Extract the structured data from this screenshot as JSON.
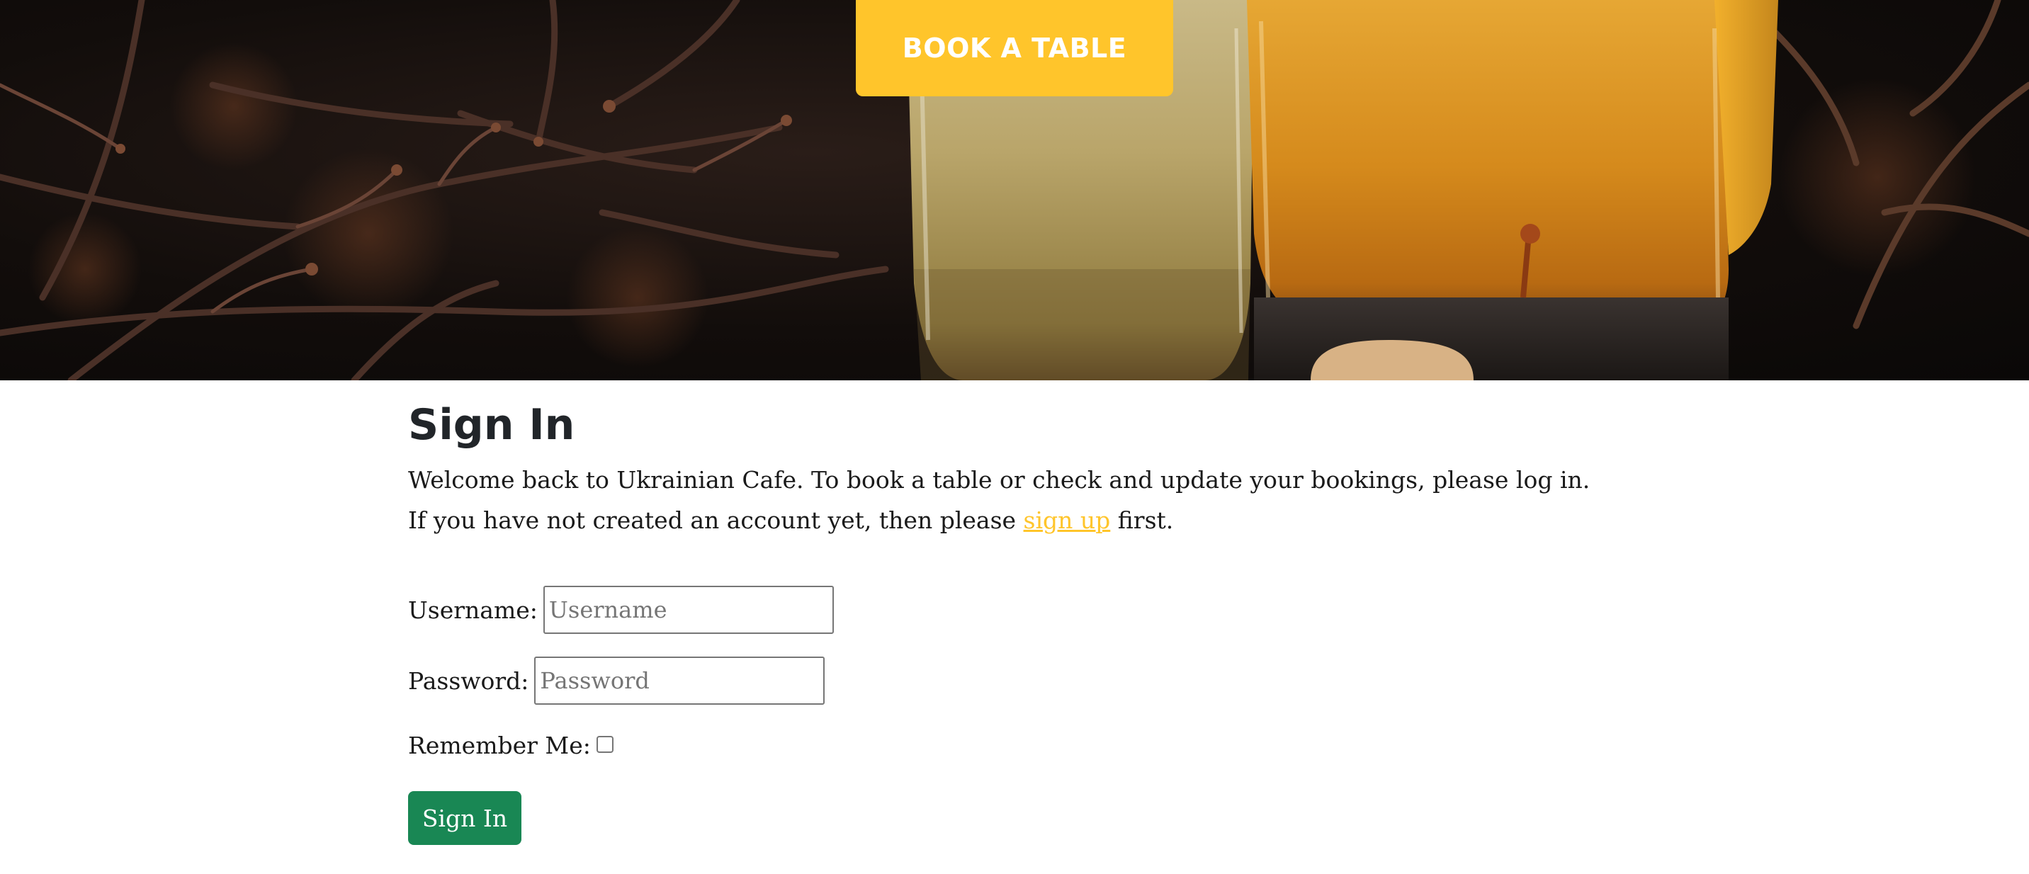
{
  "hero": {
    "book_button_label": "BOOK A TABLE"
  },
  "signin": {
    "title": "Sign In",
    "intro_before_link": "Welcome back to Ukrainian Cafe. To book a table or check and update your bookings, please log in. If you have not created an account yet, then please ",
    "signup_link_label": "sign up",
    "intro_after_link": " first.",
    "username_label": "Username:",
    "username_placeholder": "Username",
    "username_value": "",
    "password_label": "Password:",
    "password_placeholder": "Password",
    "password_value": "",
    "remember_label": "Remember Me:",
    "remember_checked": false,
    "submit_label": "Sign In"
  },
  "colors": {
    "accent_yellow": "#ffc52b",
    "submit_green": "#198754",
    "text_dark": "#212529"
  },
  "icons": {
    "remember_checkbox": "checkbox-unchecked"
  }
}
